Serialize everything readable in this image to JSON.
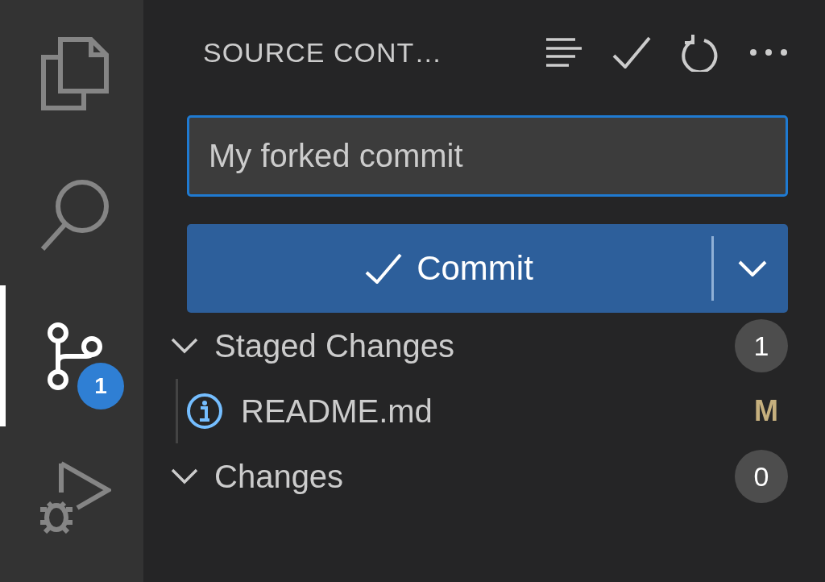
{
  "activity_bar": {
    "items": [
      {
        "selected": false
      },
      {
        "selected": false
      },
      {
        "selected": true,
        "badge": "1"
      },
      {
        "selected": false
      }
    ]
  },
  "sidebar": {
    "title": "SOURCE CONT…"
  },
  "commit_message": {
    "value": "My forked commit"
  },
  "commit_button": {
    "label": "Commit"
  },
  "groups": [
    {
      "label": "Staged Changes",
      "expanded": true,
      "count": "1",
      "files": [
        {
          "name": "README.md",
          "status": "M"
        }
      ]
    },
    {
      "label": "Changes",
      "expanded": true,
      "count": "0"
    }
  ]
}
